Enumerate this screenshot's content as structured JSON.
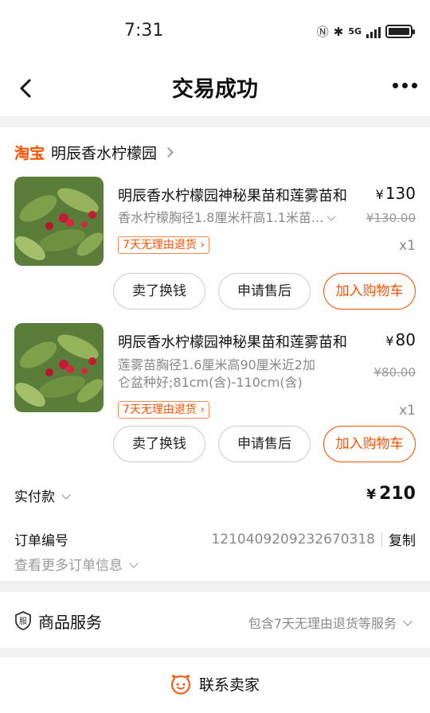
{
  "status_bar": {
    "time": "7:31",
    "network": "5G"
  },
  "nav": {
    "title": "交易成功"
  },
  "shop": {
    "platform": "淘宝",
    "name": "明辰香水柠檬园"
  },
  "items": [
    {
      "name": "明辰香水柠檬园神秘果苗和莲雾苗和",
      "price_symbol": "¥",
      "price": "130",
      "spec": "香水柠檬胸径1.8厘米杆高1.1米苗...",
      "original_price": "¥130.00",
      "tag": "7天无理由退货",
      "qty": "x1",
      "buttons": [
        "卖了换钱",
        "申请售后",
        "加入购物车"
      ]
    },
    {
      "name": "明辰香水柠檬园神秘果苗和莲雾苗和",
      "price_symbol": "¥",
      "price": "80",
      "spec_line1": "莲雾苗胸径1.6厘米高90厘米近2加",
      "spec_line2": "仑盆种好;81cm(含)-110cm(含)",
      "original_price": "¥80.00",
      "tag": "7天无理由退货",
      "qty": "x1",
      "buttons": [
        "卖了换钱",
        "申请售后",
        "加入购物车"
      ]
    }
  ],
  "payment": {
    "label": "实付款",
    "symbol": "¥",
    "amount": "210"
  },
  "order": {
    "label": "订单编号",
    "number": "1210409209232670318",
    "copy": "复制",
    "more": "查看更多订单信息"
  },
  "service": {
    "title": "商品服务",
    "desc": "包含7天无理由退货等服务",
    "icon": "shield-service-icon"
  },
  "contact": {
    "label": "联系卖家",
    "icon": "seller-chat-icon"
  },
  "colors": {
    "accent": "#ff5000",
    "text": "#111111",
    "muted": "#888888",
    "background": "#f2f2f2"
  }
}
